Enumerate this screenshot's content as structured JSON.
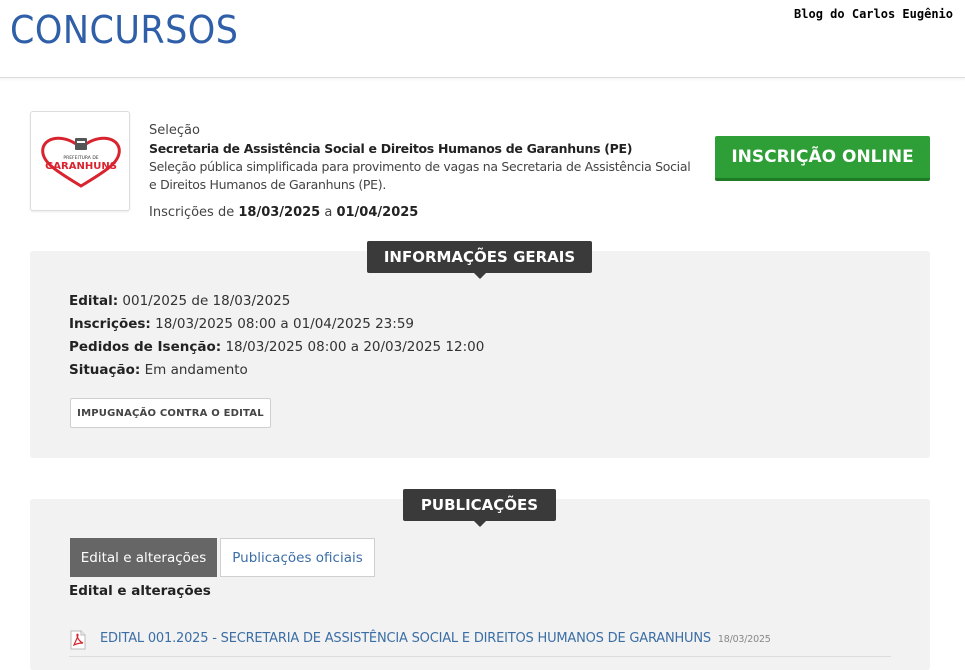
{
  "header": {
    "title": "CONCURSOS",
    "watermark": "Blog do Carlos Eugênio"
  },
  "selection": {
    "kind": "Seleção",
    "organization": "Secretaria de Assistência Social e Direitos Humanos de Garanhuns (PE)",
    "description": "Seleção pública simplificada para provimento de vagas na Secretaria de Assistência Social e Direitos Humanos de Garanhuns (PE).",
    "dates_prefix": "Inscrições de",
    "date_start": "18/03/2025",
    "dates_sep": "a",
    "date_end": "01/04/2025",
    "logo_text_top": "PREFEITURA DE",
    "logo_text_main": "GARANHUNS",
    "signup_button": "INSCRIÇÃO ONLINE"
  },
  "info": {
    "section_title": "INFORMAÇÕES GERAIS",
    "edital_label": "Edital:",
    "edital_value": "001/2025 de 18/03/2025",
    "inscricoes_label": "Inscrições:",
    "inscricoes_value": "18/03/2025 08:00 a 01/04/2025 23:59",
    "isencao_label": "Pedidos de Isenção:",
    "isencao_value": "18/03/2025 08:00 a 20/03/2025 12:00",
    "situacao_label": "Situação:",
    "situacao_value": "Em andamento",
    "impugnacao_button": "IMPUGNAÇÃO CONTRA O EDITAL"
  },
  "publications": {
    "section_title": "PUBLICAÇÕES",
    "tabs": [
      {
        "label": "Edital e alterações",
        "active": true
      },
      {
        "label": "Publicações oficiais",
        "active": false
      }
    ],
    "subsection_title": "Edital e alterações",
    "items": [
      {
        "title": "EDITAL 001.2025 - SECRETARIA DE ASSISTÊNCIA SOCIAL E DIREITOS HUMANOS DE GARANHUNS",
        "date": "18/03/2025"
      }
    ]
  },
  "colors": {
    "brand_blue": "#2f5fa8",
    "button_green": "#2e9e36",
    "dark_label": "#3a3a3a",
    "link_blue": "#3b6ea5",
    "logo_red": "#d9232e"
  },
  "icons": [
    "garanhuns-logo",
    "pdf-icon"
  ]
}
